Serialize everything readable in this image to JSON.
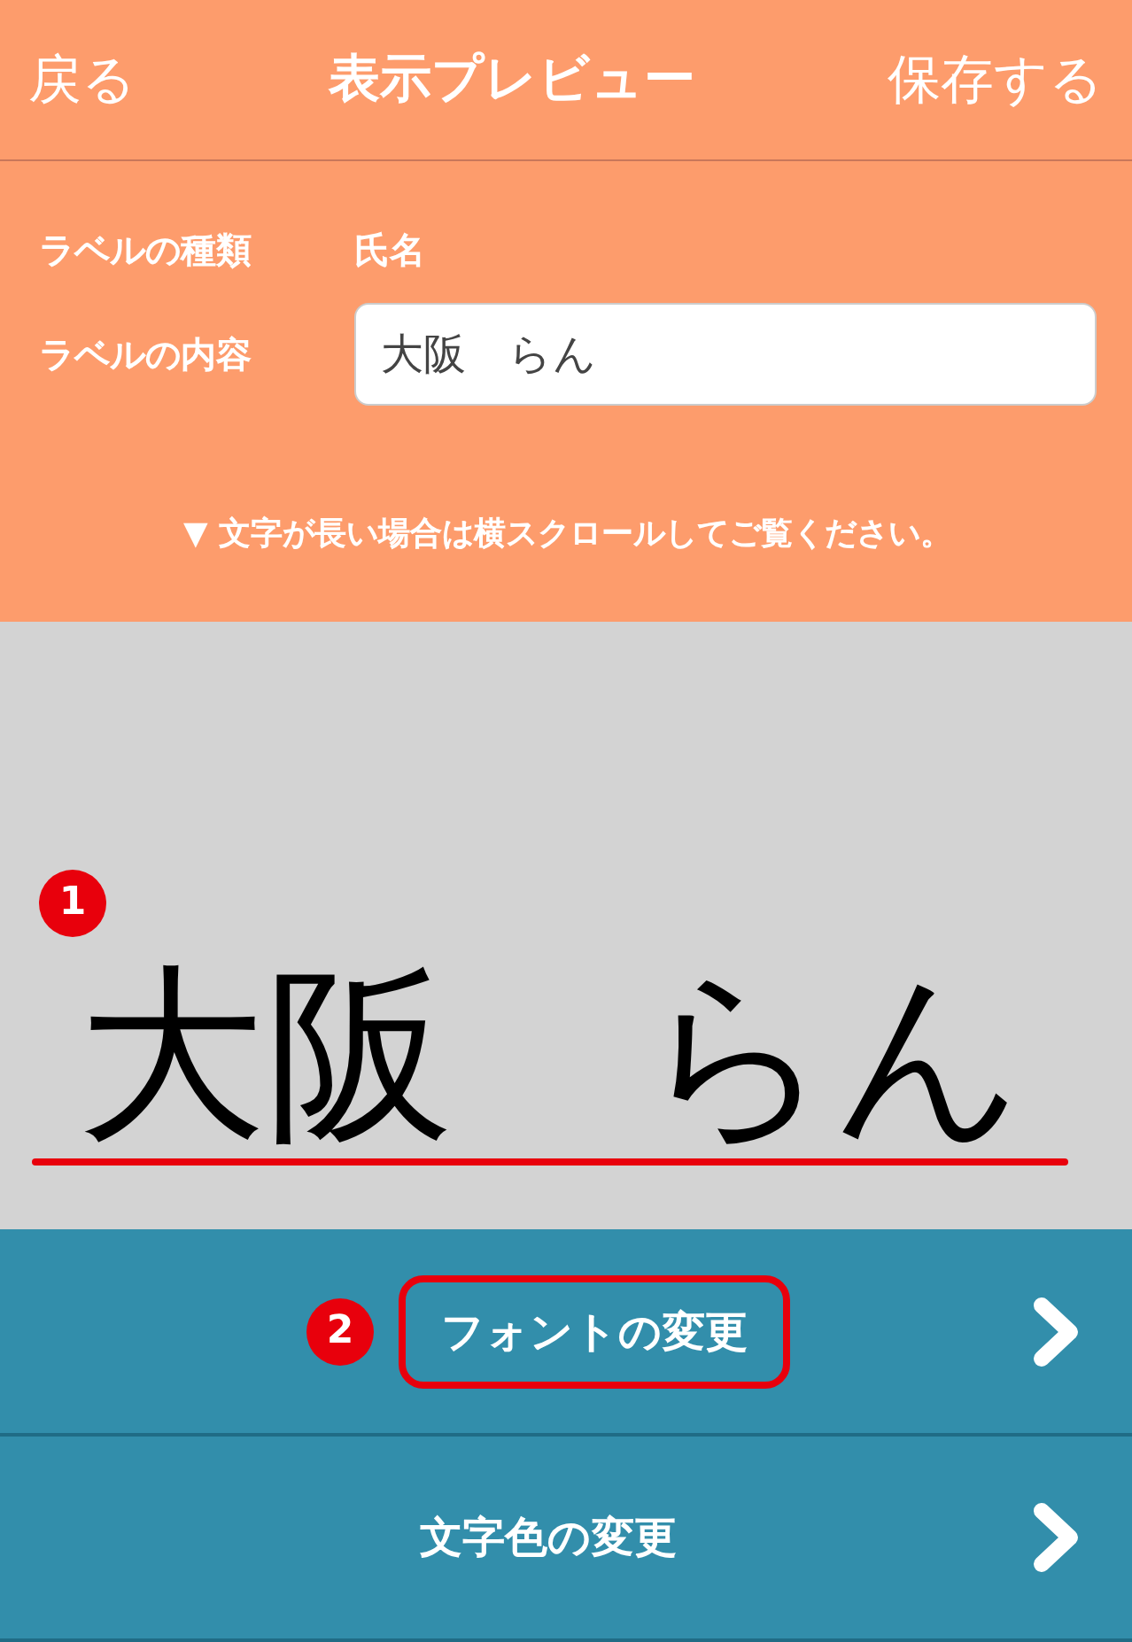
{
  "header": {
    "back": "戻る",
    "title": "表示プレビュー",
    "save": "保存する"
  },
  "form": {
    "rows": [
      {
        "kind": "text",
        "label": "ラベルの種類",
        "value": "氏名"
      },
      {
        "kind": "input",
        "label": "ラベルの内容",
        "value": "大阪　らん"
      }
    ],
    "note": "▼ 文字が長い場合は横スクロールしてご覧ください。"
  },
  "preview": {
    "text": "大阪　らん",
    "marker": "1"
  },
  "menu": [
    {
      "label": "フォントの変更",
      "marker": "2",
      "highlighted": true
    },
    {
      "label": "文字色の変更",
      "highlighted": false
    }
  ]
}
